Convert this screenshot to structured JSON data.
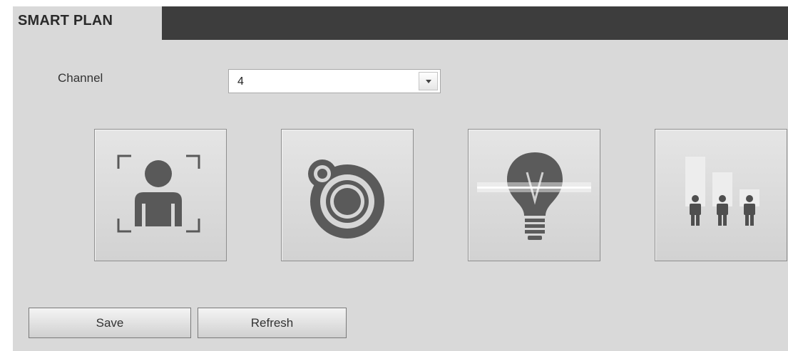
{
  "header": {
    "tab_label": "SMART PLAN"
  },
  "form": {
    "channel_label": "Channel",
    "channel_value": "4"
  },
  "plans": [
    {
      "icon": "face-detection-icon"
    },
    {
      "icon": "heat-map-icon"
    },
    {
      "icon": "smart-light-line-crossing-icon"
    },
    {
      "icon": "people-counting-icon"
    }
  ],
  "buttons": {
    "save_label": "Save",
    "refresh_label": "Refresh"
  },
  "colors": {
    "header_dark": "#3d3d3d",
    "panel_bg": "#d9d9d9",
    "icon_dark": "#595959"
  }
}
